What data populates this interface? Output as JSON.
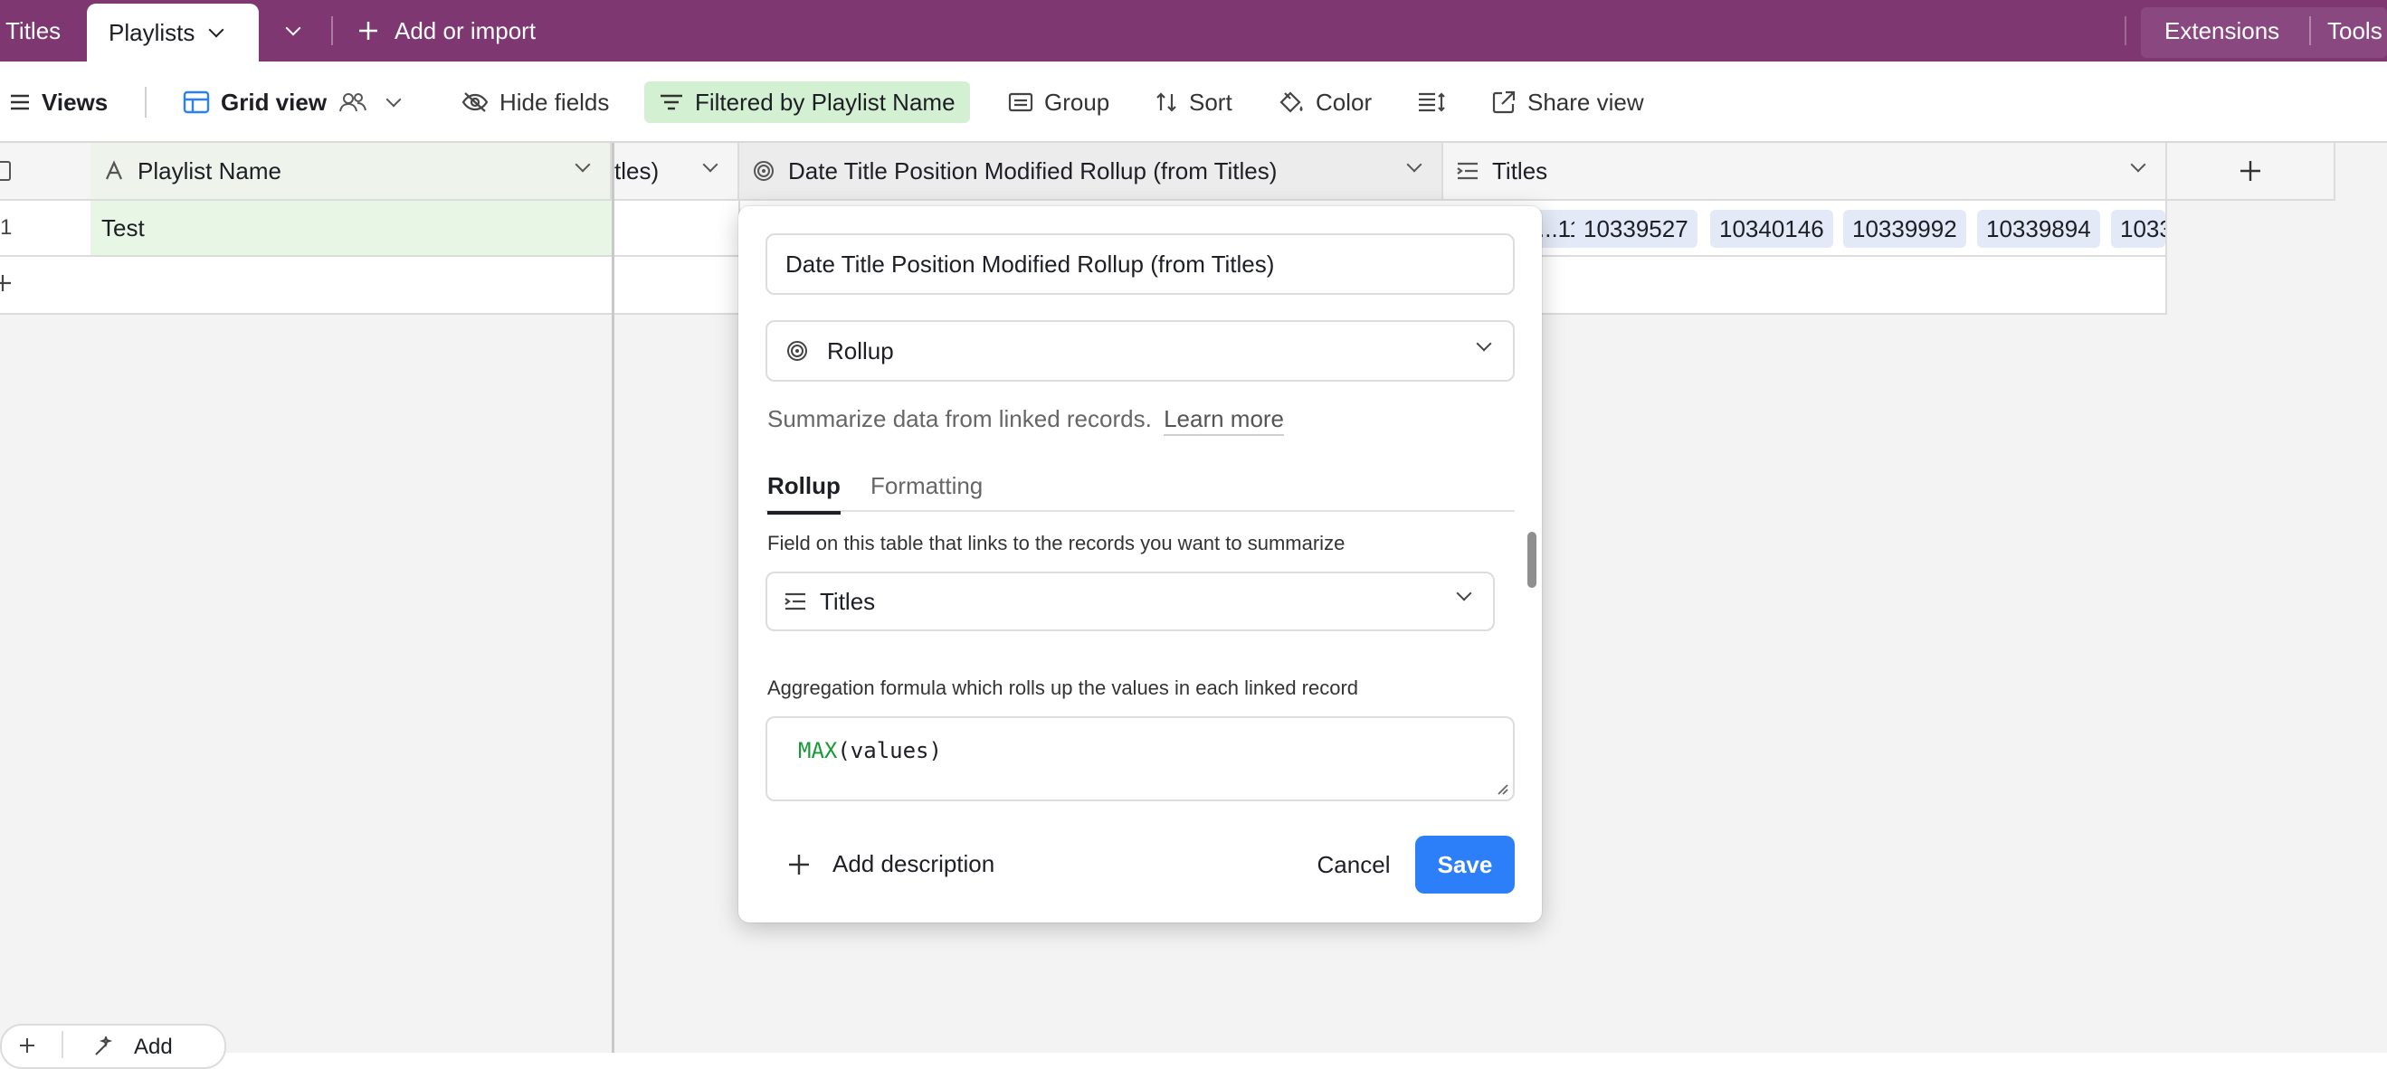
{
  "topbar": {
    "tabs": [
      {
        "label": "Titles"
      },
      {
        "label": "Playlists"
      }
    ],
    "add_import": "Add or import",
    "extensions": "Extensions",
    "tools": "Tools"
  },
  "toolbar": {
    "views": "Views",
    "grid_view": "Grid view",
    "hide_fields": "Hide fields",
    "filtered": "Filtered by Playlist Name",
    "group": "Group",
    "sort": "Sort",
    "color": "Color",
    "share_view": "Share view"
  },
  "grid": {
    "columns": {
      "playlist_name": "Playlist Name",
      "partial": "tles)",
      "date_title": "Date Title Position Modified Rollup (from Titles)",
      "titles": "Titles"
    },
    "rows": [
      {
        "number": "1",
        "playlist_name": "Test",
        "titles": [
          "...11",
          "10339527",
          "10340146",
          "10339992",
          "10339894",
          "1033..."
        ]
      }
    ],
    "bottom_add": "Add"
  },
  "modal": {
    "field_name": "Date Title Position Modified Rollup (from Titles)",
    "field_type": "Rollup",
    "description": "Summarize data from linked records.",
    "learn_more": "Learn more",
    "tabs": [
      "Rollup",
      "Formatting"
    ],
    "link_label": "Field on this table that links to the records you want to summarize",
    "link_value": "Titles",
    "aggregation_label": "Aggregation formula which rolls up the values in each linked record",
    "formula_fn": "MAX",
    "formula_args": "(values)",
    "add_description": "Add description",
    "cancel": "Cancel",
    "save": "Save"
  },
  "colors": {
    "topbar": "#7e3770",
    "filter_bg": "#d4f0d2",
    "primary_field_bg": "#e8f6e6",
    "chip_bg": "#e3e9f6",
    "save_bg": "#2d7ff9",
    "formula_fn": "#1a9a37"
  }
}
